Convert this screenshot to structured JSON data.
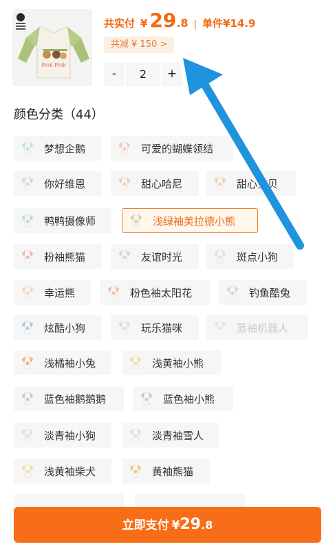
{
  "product": {
    "image_icon": "shirt-thumbnail-icon",
    "shirt_text": "Pink Pink"
  },
  "price": {
    "label": "共实付",
    "currency": "¥",
    "integer": "29",
    "decimal": ".8",
    "separator": "|",
    "unit_label": "单件¥14.9"
  },
  "discount": {
    "label": "共减 ¥ 150 >"
  },
  "quantity": {
    "minus": "-",
    "value": "2",
    "plus": "+"
  },
  "section": {
    "title": "颜色分类（44）"
  },
  "colors": [
    {
      "label": "梦想企鹅",
      "tint": "#bfe0ec",
      "state": "normal"
    },
    {
      "label": "可爱的蝴蝶领结",
      "tint": "#f0c9bf",
      "state": "normal"
    },
    {
      "label": "你好维恩",
      "tint": "#cfd6e0",
      "state": "normal"
    },
    {
      "label": "甜心哈尼",
      "tint": "#f0c8b6",
      "state": "normal"
    },
    {
      "label": "甜心宝贝",
      "tint": "#f2cda0",
      "state": "normal"
    },
    {
      "label": "鸭鸭摄像师",
      "tint": "#bfd8ee",
      "state": "normal"
    },
    {
      "label": "浅绿袖美拉德小熊",
      "tint": "#c7d3a6",
      "state": "selected"
    },
    {
      "label": "粉袖熊猫",
      "tint": "#f2b8b2",
      "state": "normal"
    },
    {
      "label": "友谊时光",
      "tint": "#cfd6e0",
      "state": "normal"
    },
    {
      "label": "斑点小狗",
      "tint": "#d9e6dc",
      "state": "normal"
    },
    {
      "label": "幸运熊",
      "tint": "#efd9c4",
      "state": "normal"
    },
    {
      "label": "粉色袖太阳花",
      "tint": "#f5b9a8",
      "state": "normal"
    },
    {
      "label": "钓鱼酷兔",
      "tint": "#cdd5e6",
      "state": "normal"
    },
    {
      "label": "炫酷小狗",
      "tint": "#a9cbe8",
      "state": "normal"
    },
    {
      "label": "玩乐猫咪",
      "tint": "#d6dee0",
      "state": "normal"
    },
    {
      "label": "蓝袖机器人",
      "tint": "#c7cfdb",
      "state": "disabled"
    },
    {
      "label": "浅橘袖小兔",
      "tint": "#f3b07a",
      "state": "normal"
    },
    {
      "label": "浅黄袖小熊",
      "tint": "#f3dea0",
      "state": "normal"
    },
    {
      "label": "蓝色袖鹅鹅鹅",
      "tint": "#b8cbe4",
      "state": "normal"
    },
    {
      "label": "蓝色袖小熊",
      "tint": "#b8cbe4",
      "state": "normal"
    },
    {
      "label": "淡青袖小狗",
      "tint": "#cfe4e6",
      "state": "normal"
    },
    {
      "label": "淡青袖雪人",
      "tint": "#cfe4e6",
      "state": "normal"
    },
    {
      "label": "浅黄袖柴犬",
      "tint": "#f3dea0",
      "state": "normal"
    },
    {
      "label": "黄袖熊猫",
      "tint": "#f2c66a",
      "state": "normal"
    }
  ],
  "pay": {
    "label": "立即支付",
    "currency": "¥",
    "integer": "29",
    "decimal": ".8"
  },
  "annotation": {
    "arrow_color": "#1f93dd",
    "icon": "pointer-arrow-icon"
  },
  "accent_color": "#f96d18"
}
